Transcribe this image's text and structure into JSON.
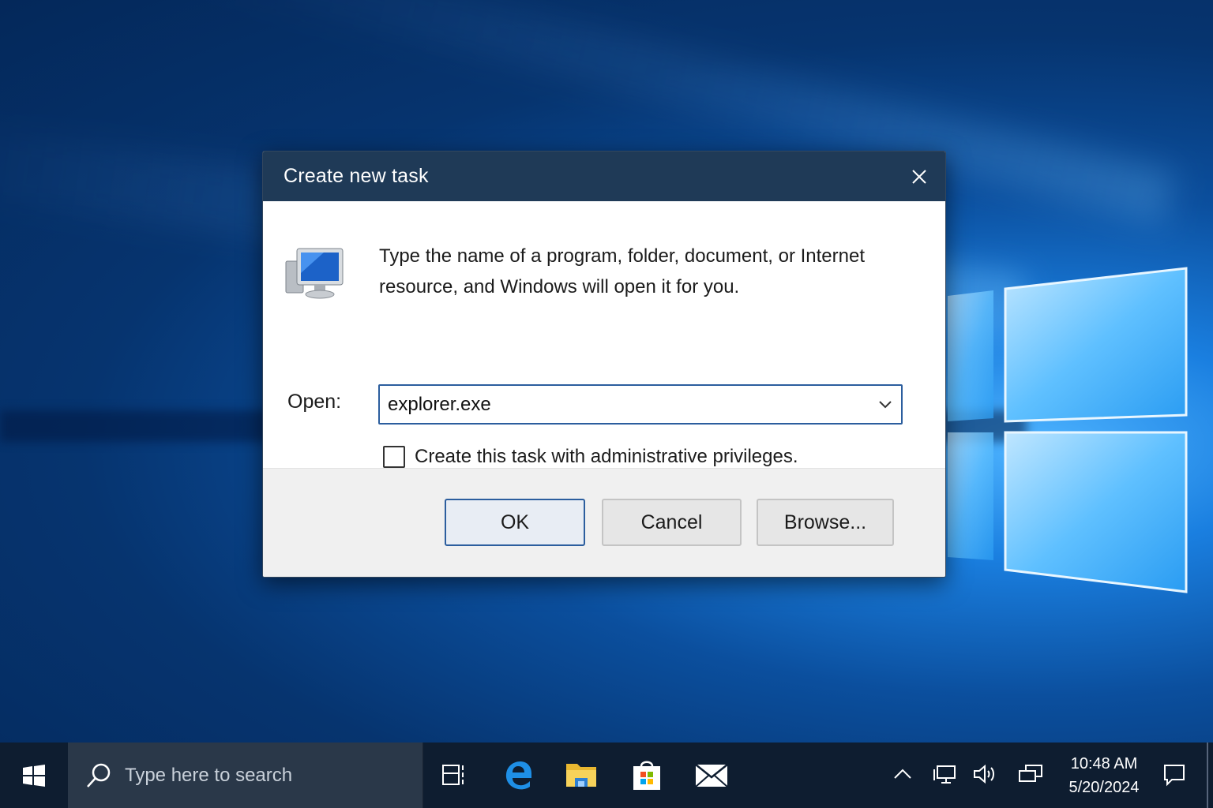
{
  "dialog": {
    "title": "Create new task",
    "description": "Type the name of a program, folder, document, or Internet resource, and Windows will open it for you.",
    "open_label": "Open:",
    "open_value": "explorer.exe",
    "admin_checkbox_label": "Create this task with administrative privileges.",
    "admin_checked": false,
    "buttons": {
      "ok": "OK",
      "cancel": "Cancel",
      "browse": "Browse..."
    }
  },
  "taskbar": {
    "search_placeholder": "Type here to search",
    "pinned": [
      "task-view-icon",
      "edge-icon",
      "file-explorer-icon",
      "store-icon",
      "mail-icon"
    ],
    "tray": [
      "chevron-up-icon",
      "network-icon",
      "volume-icon",
      "display-icon"
    ],
    "time": "10:48 AM",
    "date": "5/20/2024"
  }
}
